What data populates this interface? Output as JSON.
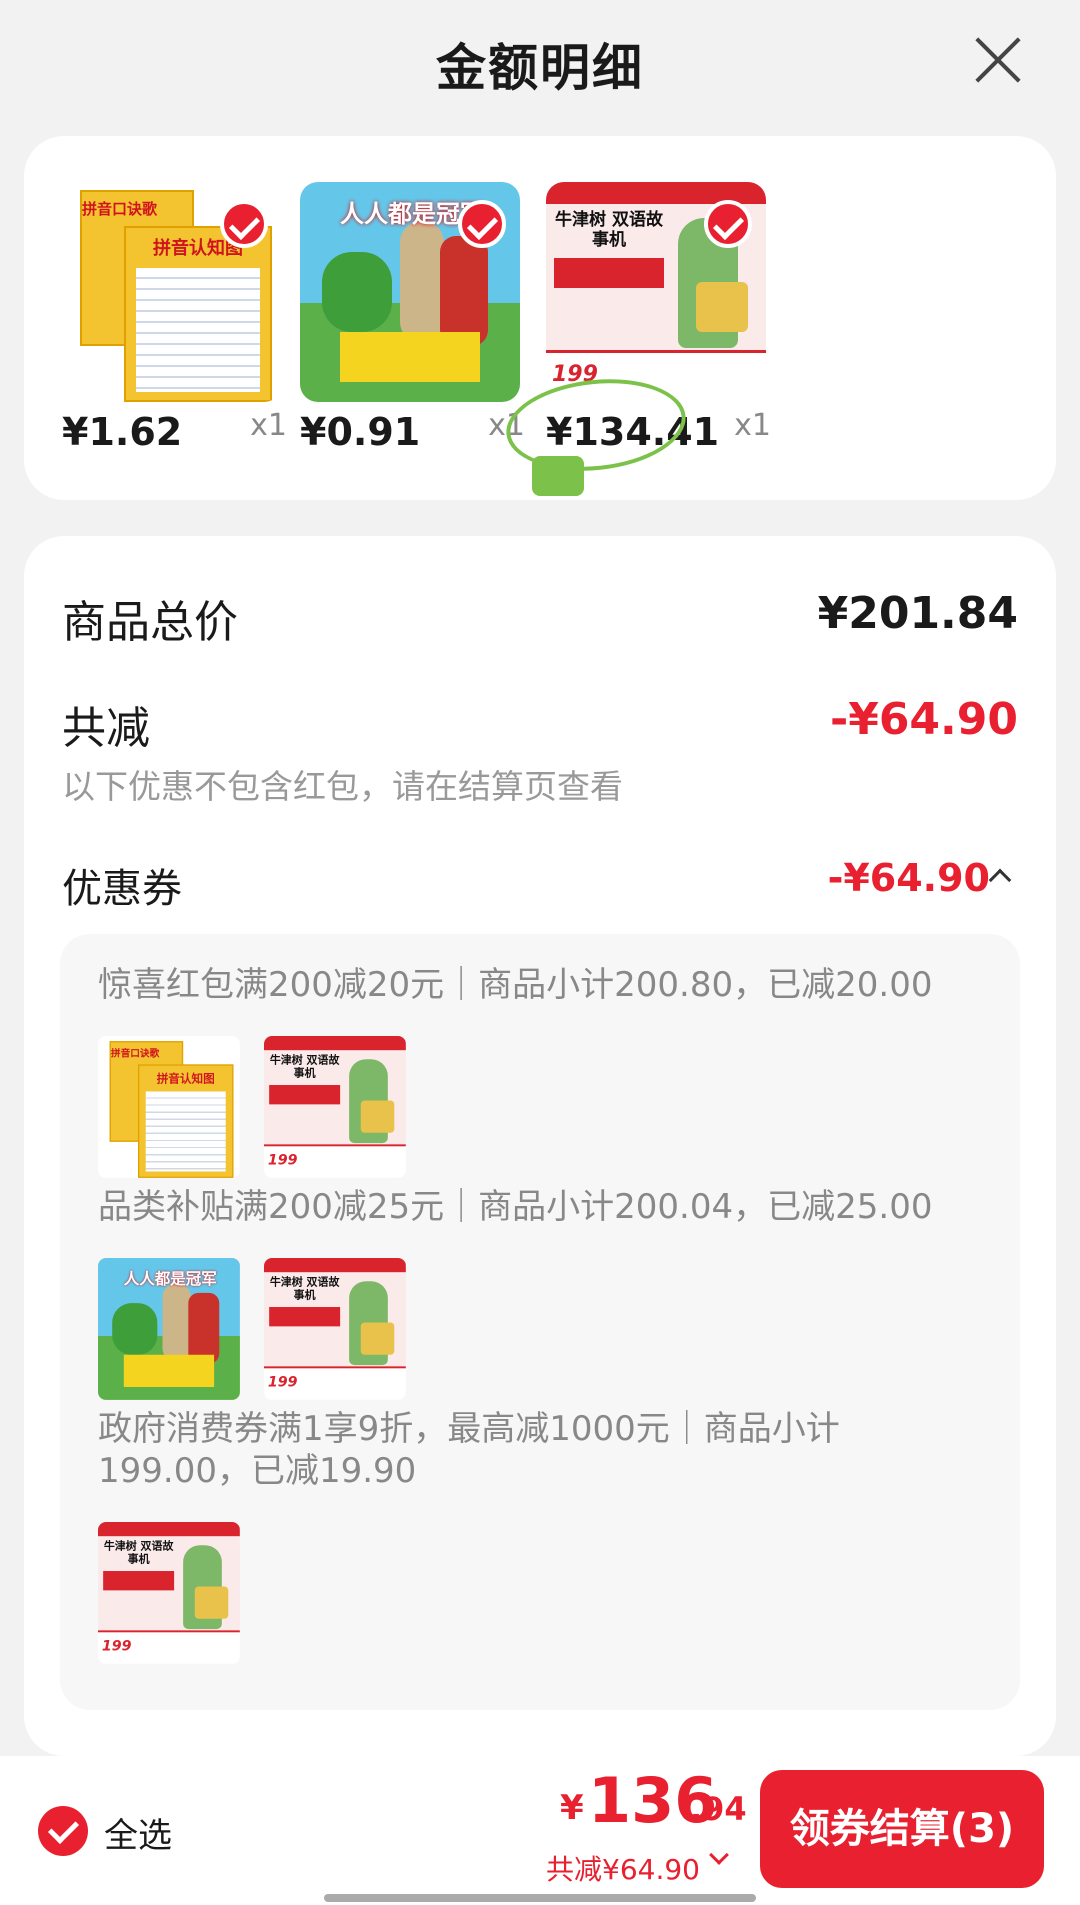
{
  "header": {
    "title": "金额明细"
  },
  "products": [
    {
      "price": "¥1.62",
      "qty": "x1",
      "thumb_title": "拼音口诀歌",
      "thumb_title2": "拼音认知图"
    },
    {
      "price": "¥0.91",
      "qty": "x1",
      "thumb_title": "人人都是冠军"
    },
    {
      "price": "¥134.41",
      "qty": "x1",
      "thumb_title": "牛津树 双语故事机",
      "thumb_price": "199"
    }
  ],
  "summary": {
    "total_label": "商品总价",
    "total_value": "¥201.84",
    "reduce_label": "共减",
    "reduce_value": "-¥64.90",
    "note": "以下优惠不包含红包，请在结算页查看",
    "coupon_label": "优惠券",
    "coupon_value": "-¥64.90"
  },
  "coupons": [
    {
      "text": "惊喜红包满200减20元｜商品小计200.80，已减20.00"
    },
    {
      "text": "品类补贴满200减25元｜商品小计200.04，已减25.00"
    },
    {
      "text_line1": "政府消费券满1享9折，最高减1000元｜商品小计",
      "text_line2": "199.00，已减19.90"
    }
  ],
  "footer": {
    "select_all": "全选",
    "currency": "¥",
    "total_int": "136",
    "total_dec": ".94",
    "saved": "共减¥64.90",
    "checkout": "领券结算(3)"
  },
  "colors": {
    "accent": "#e8202f",
    "background": "#f2f2f2",
    "annotation_circle": "#7cc24a"
  }
}
